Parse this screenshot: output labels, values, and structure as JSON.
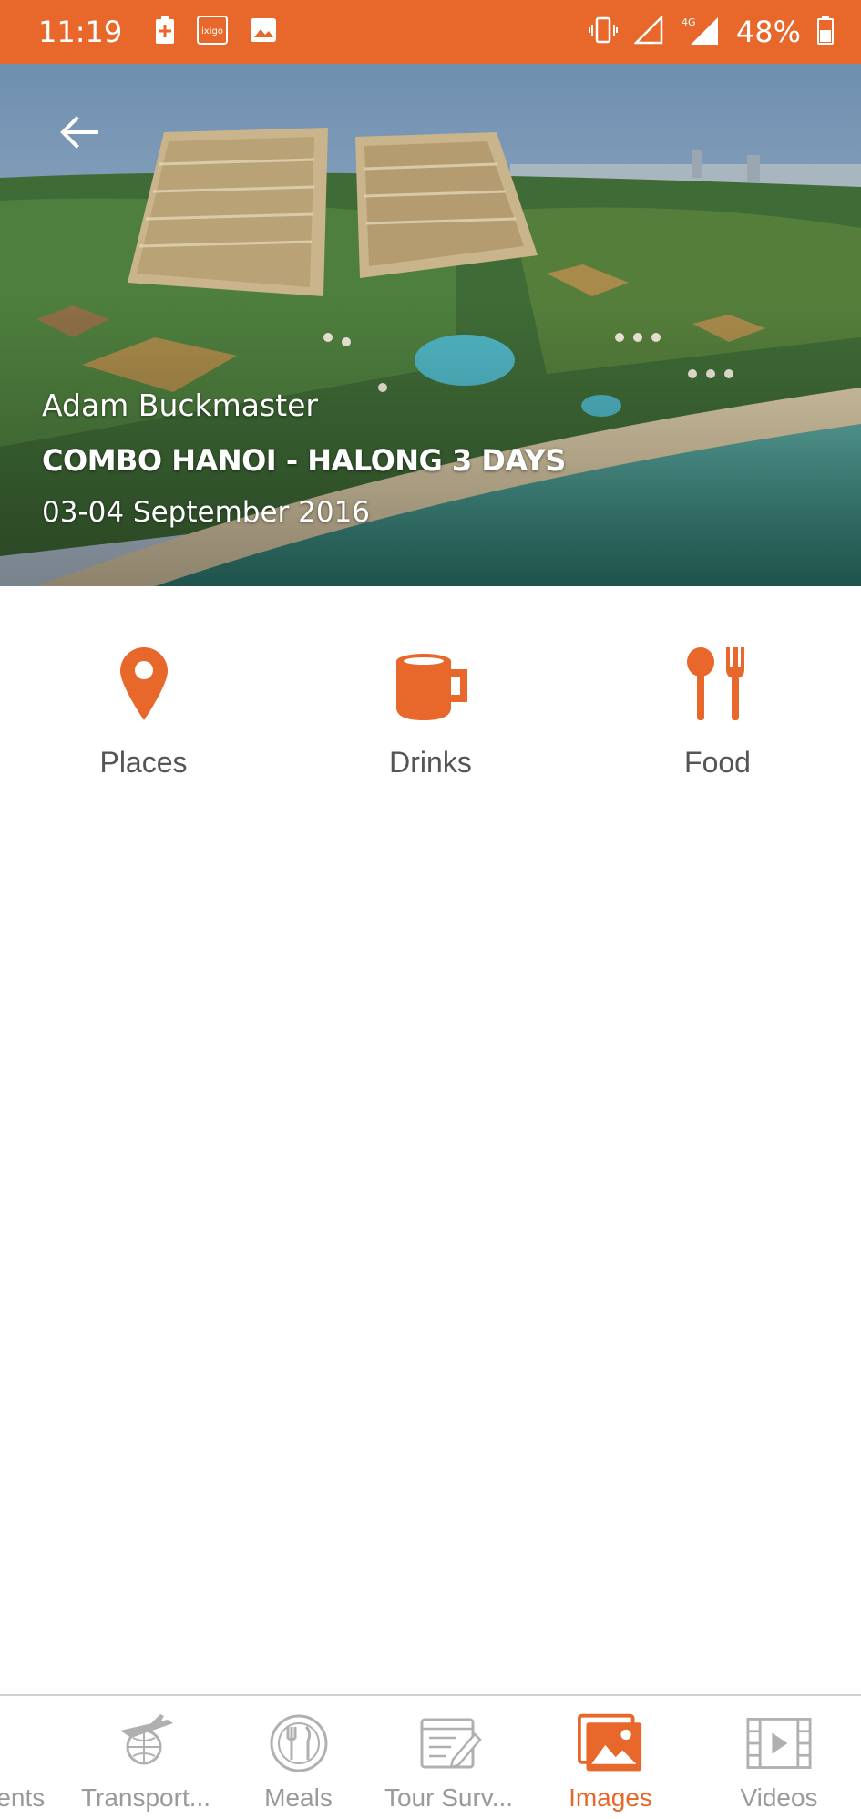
{
  "status_bar": {
    "time": "11:19",
    "battery": "48%",
    "network": "4G",
    "icons": [
      "battery-saver-icon",
      "ixigo-icon",
      "gallery-icon",
      "vibrate-icon",
      "signal-icon",
      "signal-4g-icon",
      "battery-icon"
    ],
    "ixigo_text": "ixigo"
  },
  "hero": {
    "owner": "Adam Buckmaster",
    "title": "COMBO HANOI - HALONG 3 DAYS",
    "date": "03-04 September 2016"
  },
  "categories": [
    {
      "label": "Places",
      "icon": "map-pin-icon"
    },
    {
      "label": "Drinks",
      "icon": "mug-icon"
    },
    {
      "label": "Food",
      "icon": "cutlery-icon"
    }
  ],
  "bottom_nav": {
    "items": [
      {
        "label": "nents",
        "icon": "document-icon",
        "active": false
      },
      {
        "label": "Transport...",
        "icon": "globe-plane-icon",
        "active": false
      },
      {
        "label": "Meals",
        "icon": "plate-icon",
        "active": false
      },
      {
        "label": "Tour Surv...",
        "icon": "survey-icon",
        "active": false
      },
      {
        "label": "Images",
        "icon": "images-icon",
        "active": true
      },
      {
        "label": "Videos",
        "icon": "film-icon",
        "active": false
      }
    ]
  },
  "colors": {
    "accent": "#e8672a",
    "inactive": "#9a9a9a",
    "label": "#555555"
  }
}
